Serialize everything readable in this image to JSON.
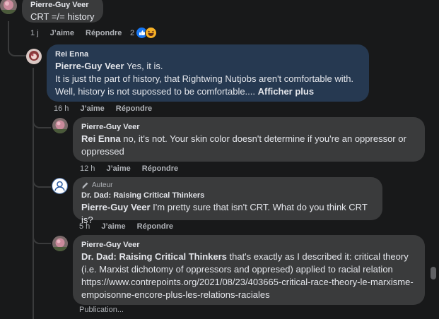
{
  "comments": [
    {
      "author": "Pierre-Guy Veer",
      "text": "CRT =/= history",
      "time": "1 j",
      "like": "J’aime",
      "reply": "Répondre",
      "reaction_count": "2",
      "reactions": [
        "like-reaction-icon",
        "haha-reaction-icon"
      ]
    },
    {
      "author": "Rei Enna",
      "mention": "Pierre-Guy Veer",
      "line1": " Yes, it is.",
      "line2": "It is just the part of history, that Rightwing Nutjobs aren't comfortable with.",
      "line3": "Well, history is not supossed to be comfortable.... ",
      "see_more": "Afficher plus",
      "time": "16 h",
      "like": "J’aime",
      "reply": "Répondre"
    },
    {
      "author": "Pierre-Guy Veer",
      "mention": "Rei Enna",
      "text": " no, it's not. Your skin color doesn't determine if you're an oppressor or oppressed",
      "time": "12 h",
      "like": "J’aime",
      "reply": "Répondre"
    },
    {
      "badge": "Auteur",
      "author": "Dr. Dad: Raising Critical Thinkers",
      "mention": "Pierre-Guy Veer",
      "text": " I'm pretty sure that isn't CRT. What do you think CRT is?",
      "time": "5 h",
      "like": "J’aime",
      "reply": "Répondre"
    },
    {
      "author": "Pierre-Guy Veer",
      "mention": "Dr. Dad: Raising Critical Thinkers",
      "text": " that's exactly as I described it: critical theory (i.e. Marxist dichotomy of oppressors and oppresed) applied to racial relation https://www.contrepoints.org/2021/08/23/403665-critical-race-theory-le-marxisme-empoisonne-encore-plus-les-relations-raciales",
      "status": "Publication..."
    }
  ],
  "colors": {
    "background": "#18191a",
    "bubble": "#3a3b3c",
    "highlight": "#263951",
    "text": "#e4e6eb",
    "muted": "#b0b3b8"
  }
}
